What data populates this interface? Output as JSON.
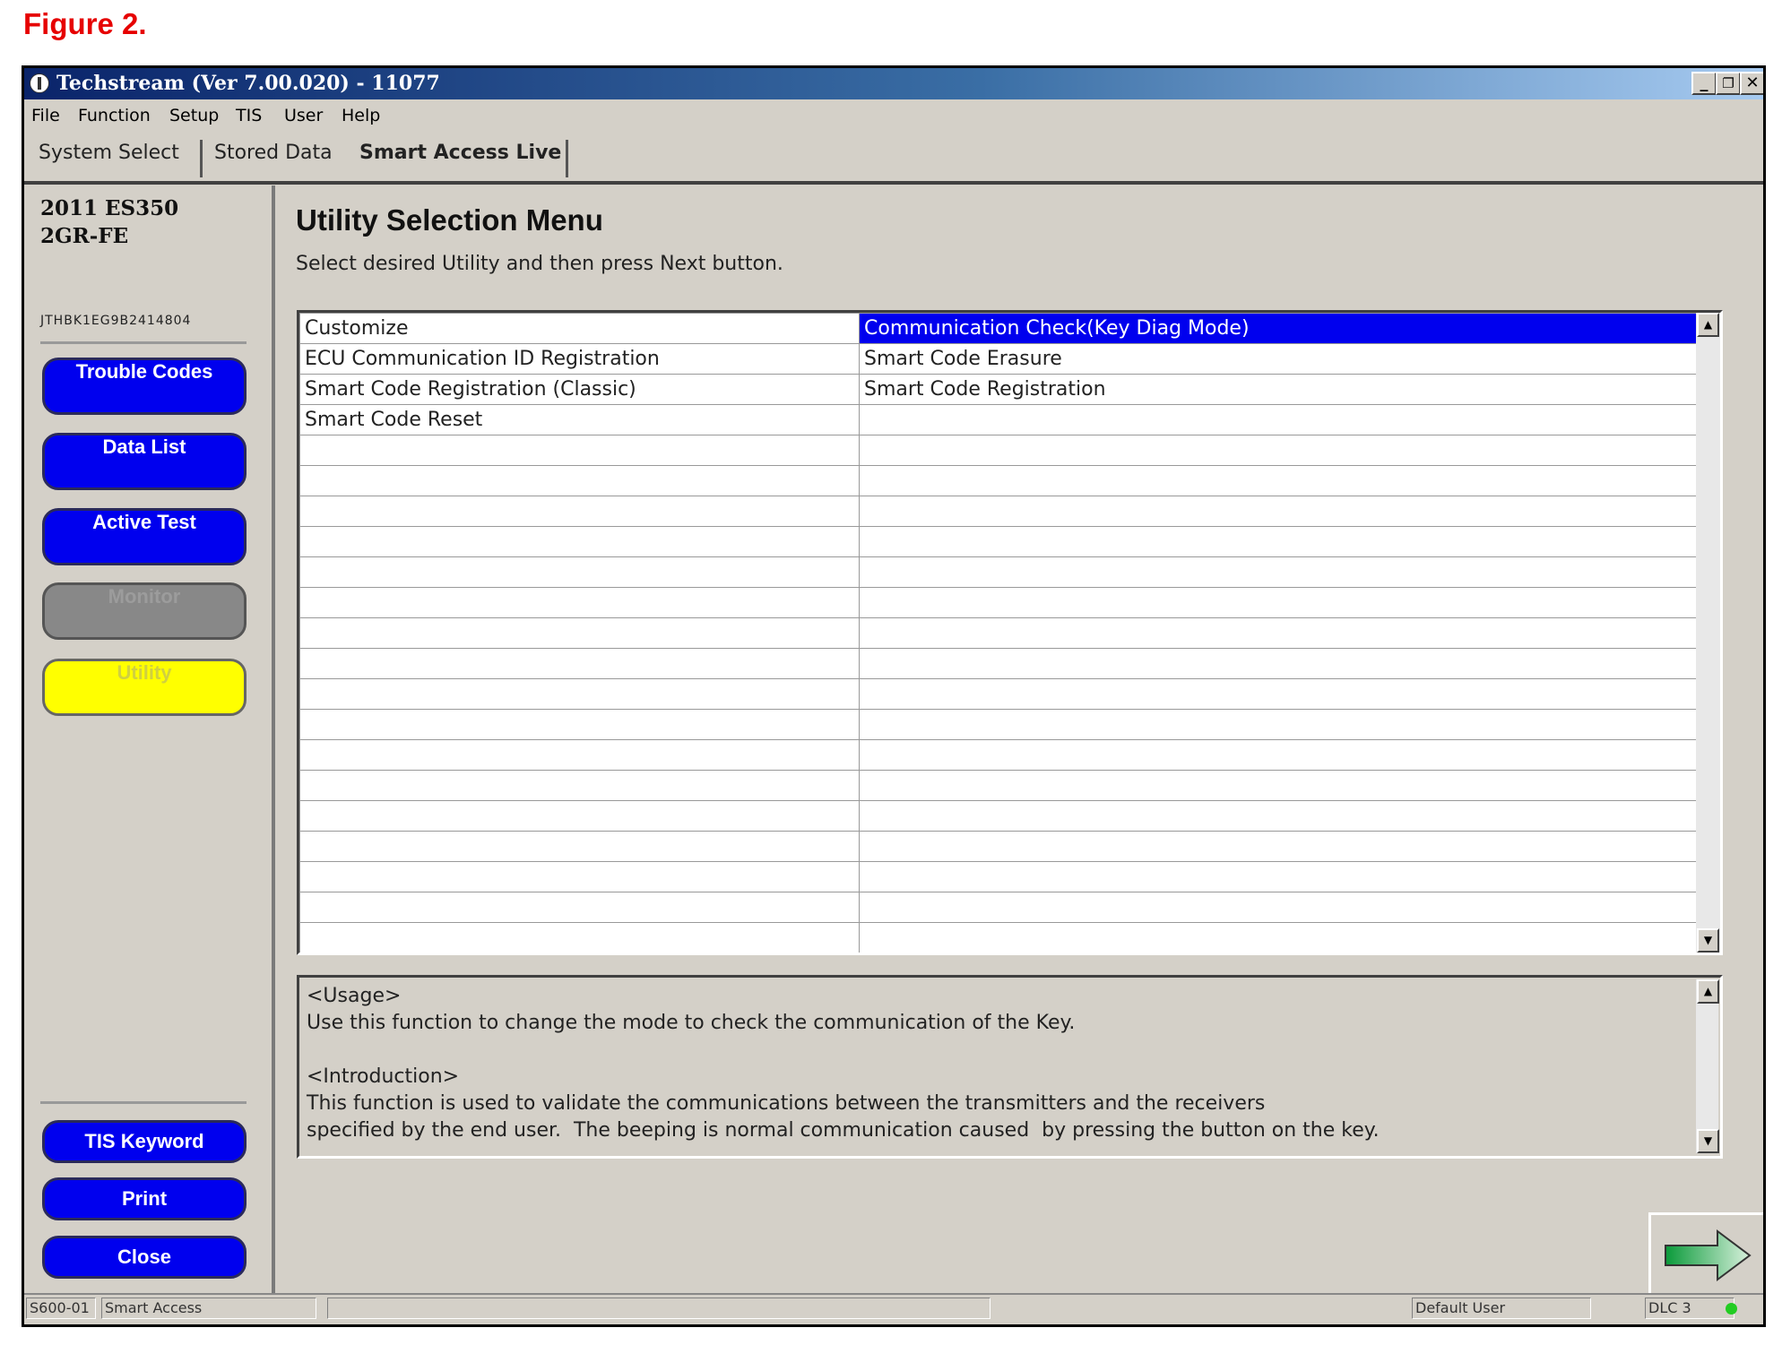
{
  "caption": "Figure 2.",
  "window": {
    "title": "Techstream (Ver 7.00.020) - 11077",
    "controls": {
      "minimize": "_",
      "restore": "❐",
      "close": "✕"
    }
  },
  "menu": {
    "items": [
      "File",
      "Function",
      "Setup",
      "TIS",
      "User",
      "Help"
    ]
  },
  "tabs": [
    "System Select",
    "Stored Data",
    "Smart Access Live"
  ],
  "vehicle": {
    "model": "2011 ES350",
    "engine": "2GR-FE",
    "vin": "JTHBK1EG9B2414804"
  },
  "left_buttons": [
    "Trouble Codes",
    "Data List",
    "Active Test",
    "Monitor",
    "Utility"
  ],
  "bottom_buttons": [
    "TIS Keyword",
    "Print",
    "Close"
  ],
  "main": {
    "title": "Utility Selection Menu",
    "subtitle": "Select desired Utility and then press Next button.",
    "utilities": [
      [
        "Customize",
        "Communication Check(Key Diag Mode)"
      ],
      [
        "ECU Communication ID Registration",
        "Smart Code Erasure"
      ],
      [
        "Smart Code Registration (Classic)",
        "Smart Code Registration"
      ],
      [
        "Smart Code Reset",
        ""
      ]
    ],
    "selected": "Communication Check(Key Diag Mode)",
    "usage_heading": "<Usage>",
    "usage_text": "Use this function to change the mode to check the communication of the Key.",
    "intro_heading": "<Introduction>",
    "intro_text_1": "This function is used to validate the communications between the transmitters and the receivers",
    "intro_text_2": "specified by the end user.  The beeping is normal communication caused  by pressing the button on the key."
  },
  "status": {
    "code": "S600-01",
    "system": "Smart Access",
    "user": "Default User",
    "connector": "DLC 3"
  },
  "colors": {
    "selected": "#0000ee",
    "utility_button": "#ffff00",
    "caption": "#e60000",
    "connection_led": "#22cc22"
  }
}
